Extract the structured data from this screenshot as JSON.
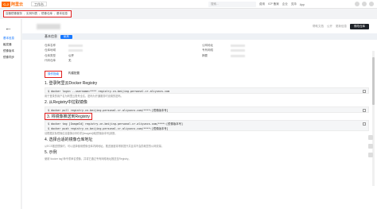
{
  "topbar": {
    "logo_mark": "C-J",
    "logo_text": "阿里云",
    "workbench": "工作台",
    "search_placeholder": "搜索...",
    "links": [
      "费用",
      "ICP 备案",
      "企业",
      "支持",
      "App"
    ]
  },
  "breadcrumb": [
    "容器镜像服务",
    "实例列表",
    "镜像仓库",
    "基本信息"
  ],
  "sidebar": {
    "items": [
      {
        "label": "基本信息",
        "active": true
      },
      {
        "label": "触发器",
        "active": false
      },
      {
        "label": "镜像版本",
        "active": false
      },
      {
        "label": "镜像同步",
        "active": false
      }
    ]
  },
  "page": {
    "actions": [
      "帮助文档",
      "公开",
      "更新信息"
    ],
    "primary_action": "修改仓库"
  },
  "basic_info": {
    "header": "基本信息",
    "badge": "私有",
    "left": [
      {
        "label": "仓库名称",
        "value": ""
      },
      {
        "label": "仓库地域",
        "value": ""
      },
      {
        "label": "仓库类型",
        "value": "公开"
      },
      {
        "label": "代码仓库",
        "value": "无"
      }
    ],
    "right": [
      {
        "label": "公网地址",
        "value": ""
      },
      {
        "label": "专有网络",
        "value": ""
      },
      {
        "label": "摘要",
        "value": ""
      }
    ]
  },
  "tabs": [
    {
      "label": "操作指南",
      "active": true
    },
    {
      "label": "构建配置",
      "active": false
    }
  ],
  "steps": [
    {
      "title": "1. 登录阿里云Docker Registry",
      "code": "$ docker login --username=**** registry.cn-beijing.personal.cr.aliyuncs.com",
      "note": "用于登录的用户名为阿里云账号全名，密码为开通服务时设置的密码。"
    },
    {
      "title": "2. 从Registry中拉取镜像",
      "code": "$ docker pull registry.cn-beijing.personal.cr.aliyuncs.com/****:[镜像版本号]",
      "note": ""
    },
    {
      "title": "3. 将镜像推送到Registry",
      "code": "$ docker tag [ImageId] registry.cn-beijing.personal.cr.aliyuncs.com/****:[镜像版本号]",
      "code2": "$ docker push registry.cn-beijing.personal.cr.aliyuncs.com/****:[镜像版本号]",
      "note": "请根据实际镜像信息替换示例中的[ImageId]和[镜像版本号]参数。"
    },
    {
      "title": "4. 选择合适的镜像仓库地址",
      "code": "",
      "note": "从ECS推送镜像时，可以选择使用镜像仓库内网地址。推送速度将得到提升并且将不会损耗您的公网流量。"
    },
    {
      "title": "5. 示例",
      "code": "",
      "note": "使用\"docker tag\"命令重命名镜像，并将它通过专有网络地址推送至Registry。"
    }
  ]
}
